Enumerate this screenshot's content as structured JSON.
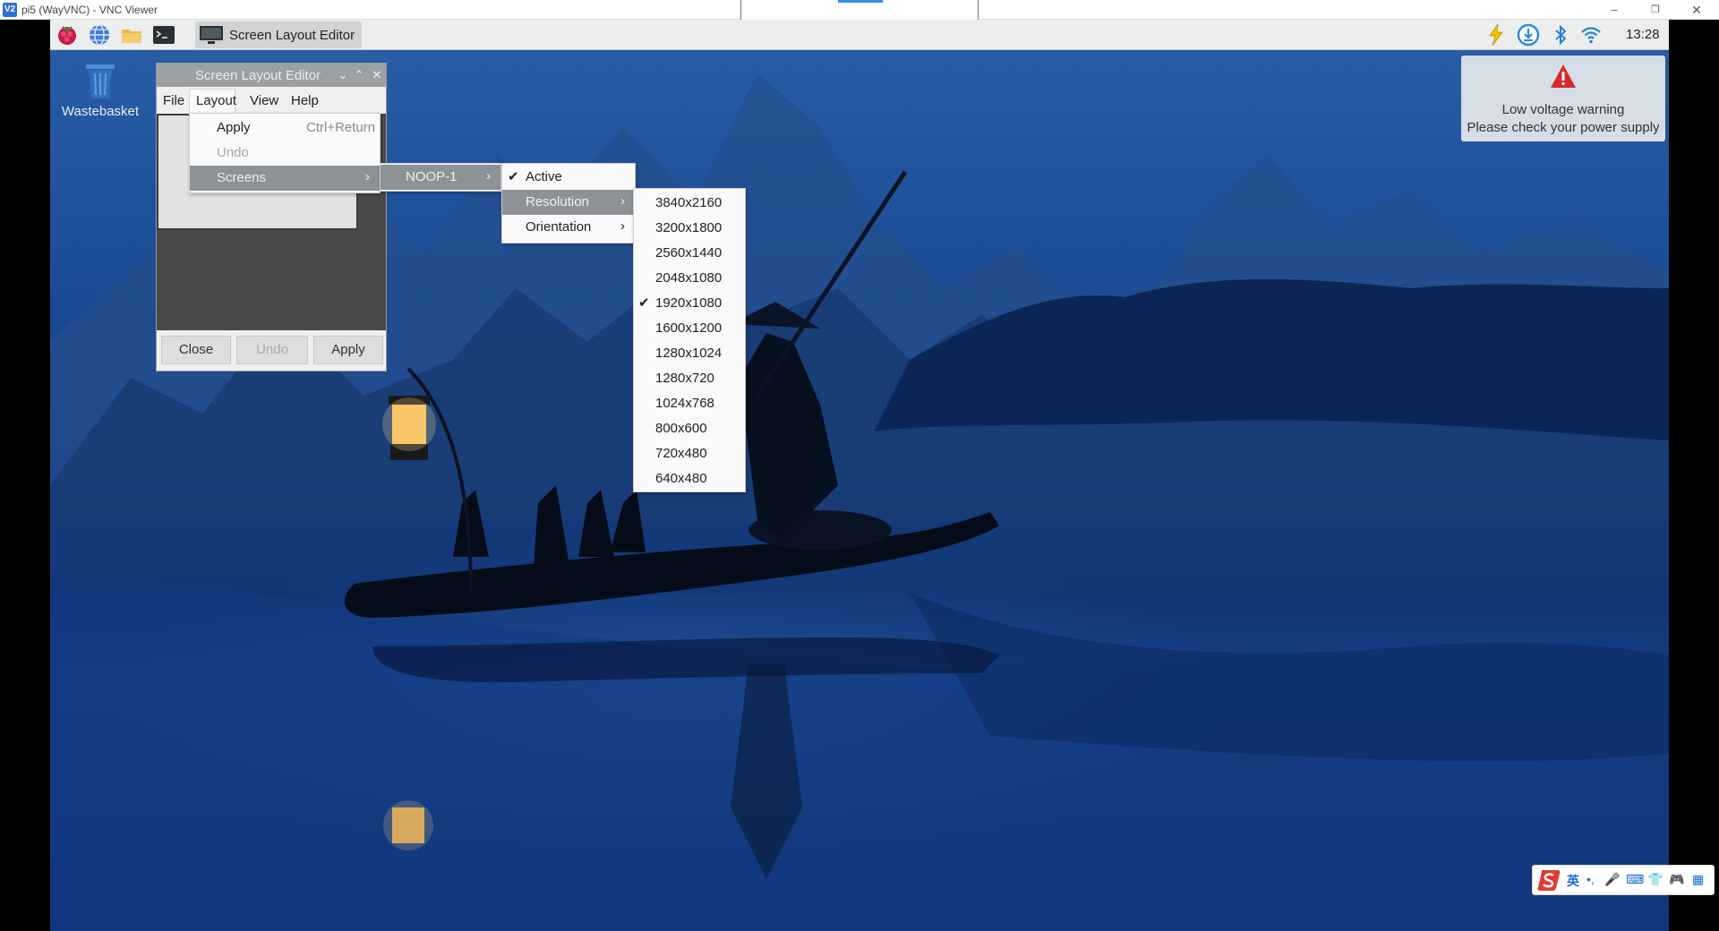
{
  "vnc_window": {
    "app_icon": "V2",
    "title": "pi5 (WayVNC) - VNC Viewer",
    "minimize": "–",
    "maximize": "❐",
    "close": "✕"
  },
  "panel": {
    "icons": [
      "raspberry-menu-icon",
      "web-browser-icon",
      "file-manager-icon",
      "terminal-icon"
    ],
    "taskbar_item": "Screen Layout Editor",
    "tray_icons": [
      "low-voltage-icon",
      "updates-icon",
      "bluetooth-icon",
      "wifi-icon"
    ],
    "clock": "13:28"
  },
  "desktop": {
    "wastebasket_label": "Wastebasket"
  },
  "notification": {
    "line1": "Low voltage warning",
    "line2": "Please check your power supply"
  },
  "app_window": {
    "title": "Screen Layout Editor",
    "controls": {
      "menu": "⌄",
      "minimize": "⌃",
      "close": "✕"
    },
    "menus": [
      "File",
      "Layout",
      "View",
      "Help"
    ],
    "buttons": {
      "close": "Close",
      "undo": "Undo",
      "apply": "Apply"
    }
  },
  "layout_menu": {
    "items": [
      {
        "label": "Apply",
        "accel": "Ctrl+Return"
      },
      {
        "label": "Undo",
        "disabled": true
      },
      {
        "label": "Screens",
        "submenu": true,
        "selected": true
      }
    ]
  },
  "screens_menu": {
    "items": [
      {
        "label": "NOOP-1",
        "submenu": true,
        "selected": true
      }
    ]
  },
  "noop_menu": {
    "items": [
      {
        "label": "Active",
        "checked": true
      },
      {
        "label": "Resolution",
        "submenu": true,
        "selected": true
      },
      {
        "label": "Orientation",
        "submenu": true
      }
    ]
  },
  "resolution_menu": {
    "checked_index": 4,
    "items": [
      "3840x2160",
      "3200x1800",
      "2560x1440",
      "2048x1080",
      "1920x1080",
      "1600x1200",
      "1280x1024",
      "1280x720",
      "1024x768",
      "800x600",
      "720x480",
      "640x480"
    ]
  },
  "ime_toolbar": {
    "items": [
      "英",
      "•,",
      "🎤",
      "⌨",
      "👕",
      "🎮",
      "▦"
    ]
  },
  "colors": {
    "panel_bg": "#eceded",
    "menu_bg": "#fafafa",
    "menu_selected": "#8d9297",
    "desktop_blue": "#1d4f99",
    "warning_red": "#d62a2a"
  }
}
